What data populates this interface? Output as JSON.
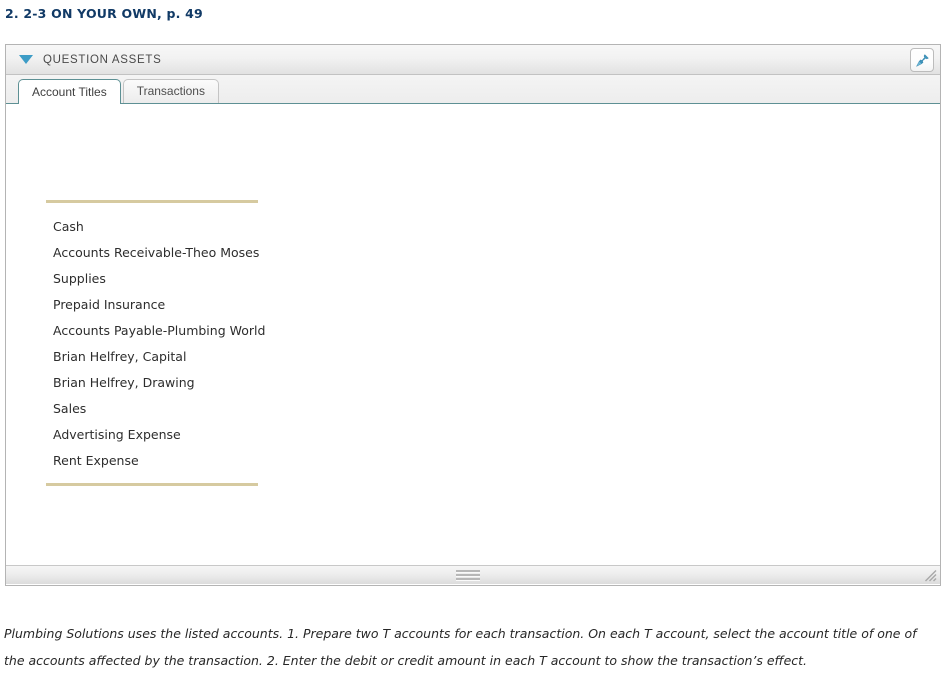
{
  "page_title": "2. 2-3 ON YOUR OWN, p. 49",
  "panel": {
    "header_title": "QUESTION ASSETS",
    "collapse_icon": "triangle-down-icon",
    "pin_icon": "pushpin-icon",
    "accent_color": "#3d9cc6",
    "rule_color": "#d6caa0",
    "active_tab_border_color": "#5d9094"
  },
  "tabs": [
    {
      "label": "Account Titles",
      "active": true
    },
    {
      "label": "Transactions",
      "active": false
    }
  ],
  "accounts": [
    "Cash",
    "Accounts Receivable-Theo Moses",
    "Supplies",
    "Prepaid Insurance",
    "Accounts Payable-Plumbing World",
    "Brian Helfrey, Capital",
    "Brian Helfrey, Drawing",
    "Sales",
    "Advertising Expense",
    "Rent Expense"
  ],
  "footer": {
    "drag_handle_icon": "drag-handle-icon",
    "resize_grip_icon": "resize-grip-icon"
  },
  "instructions": "Plumbing Solutions uses the listed accounts. 1. Prepare two T accounts for each transaction. On each T account, select the account title of one of the accounts affected by the transaction. 2. Enter the debit or credit amount in each T account to show the transaction’s effect."
}
